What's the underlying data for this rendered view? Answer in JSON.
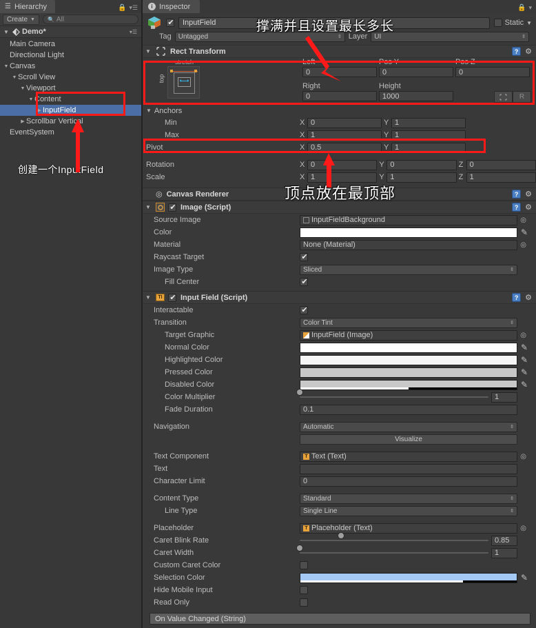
{
  "hierarchy": {
    "tab_label": "Hierarchy",
    "tab_icon": "list-icon",
    "lock_icon": "lock-icon",
    "menu_icon": "panel-menu-icon",
    "create_label": "Create",
    "search_placeholder": "All",
    "search_value": "",
    "scene_name": "Demo*",
    "items": [
      {
        "label": "Main Camera",
        "depth": 1,
        "arrow": "none",
        "selected": false
      },
      {
        "label": "Directional Light",
        "depth": 1,
        "arrow": "none",
        "selected": false
      },
      {
        "label": "Canvas",
        "depth": 1,
        "arrow": "expanded",
        "selected": false
      },
      {
        "label": "Scroll View",
        "depth": 2,
        "arrow": "expanded",
        "selected": false
      },
      {
        "label": "Viewport",
        "depth": 3,
        "arrow": "expanded",
        "selected": false
      },
      {
        "label": "Content",
        "depth": 4,
        "arrow": "expanded",
        "selected": false
      },
      {
        "label": "InputField",
        "depth": 5,
        "arrow": "collapsed",
        "selected": true
      },
      {
        "label": "Scrollbar Vertical",
        "depth": 3,
        "arrow": "collapsed",
        "selected": false
      },
      {
        "label": "EventSystem",
        "depth": 1,
        "arrow": "none",
        "selected": false
      }
    ],
    "annotation": "创建一个InputField"
  },
  "inspector": {
    "tab_label": "Inspector",
    "tab_icon": "info-icon",
    "lock_icon": "lock-icon",
    "object": {
      "enabled": true,
      "name": "InputField",
      "static_label": "Static",
      "static_checked": false,
      "tag_label": "Tag",
      "tag_value": "Untagged",
      "layer_label": "Layer",
      "layer_value": "UI"
    },
    "rect_transform": {
      "title": "Rect Transform",
      "anchor_preset_h": "stretch",
      "anchor_preset_v": "top",
      "fields": {
        "left_label": "Left",
        "left_value": "0",
        "posy_label": "Pos Y",
        "posy_value": "0",
        "posz_label": "Pos Z",
        "posz_value": "0",
        "right_label": "Right",
        "right_value": "0",
        "height_label": "Height",
        "height_value": "1000"
      },
      "blueprint_label": "",
      "raw_label": "R",
      "anchors_label": "Anchors",
      "min_label": "Min",
      "min_x": "0",
      "min_y": "1",
      "max_label": "Max",
      "max_x": "1",
      "max_y": "1",
      "pivot_label": "Pivot",
      "pivot_x": "0.5",
      "pivot_y": "1",
      "rotation_label": "Rotation",
      "rot_x": "0",
      "rot_y": "0",
      "rot_z": "0",
      "scale_label": "Scale",
      "scale_x": "1",
      "scale_y": "1",
      "scale_z": "1"
    },
    "canvas_renderer": {
      "title": "Canvas Renderer",
      "icon": "eye-icon"
    },
    "image_script": {
      "title": "Image (Script)",
      "enabled": true,
      "source_image_label": "Source Image",
      "source_image_value": "InputFieldBackground",
      "color_label": "Color",
      "color_value": "#FFFFFF",
      "material_label": "Material",
      "material_value": "None (Material)",
      "raycast_label": "Raycast Target",
      "raycast_checked": true,
      "image_type_label": "Image Type",
      "image_type_value": "Sliced",
      "fill_center_label": "Fill Center",
      "fill_center_checked": true
    },
    "input_field_script": {
      "title": "Input Field (Script)",
      "enabled": true,
      "interactable_label": "Interactable",
      "interactable_checked": true,
      "transition_label": "Transition",
      "transition_value": "Color Tint",
      "target_graphic_label": "Target Graphic",
      "target_graphic_value": "InputField (Image)",
      "normal_color_label": "Normal Color",
      "normal_color_value": "#FFFFFF",
      "highlighted_color_label": "Highlighted Color",
      "highlighted_color_value": "#F5F5F5",
      "pressed_color_label": "Pressed Color",
      "pressed_color_value": "#C8C8C8",
      "disabled_color_label": "Disabled Color",
      "disabled_color_value": "#C8C8C8",
      "disabled_color_alpha_pct": 50,
      "color_multiplier_label": "Color Multiplier",
      "color_multiplier_value": "1",
      "color_multiplier_pct": 0,
      "fade_duration_label": "Fade Duration",
      "fade_duration_value": "0.1",
      "navigation_label": "Navigation",
      "navigation_value": "Automatic",
      "visualize_label": "Visualize",
      "text_component_label": "Text Component",
      "text_component_value": "Text (Text)",
      "text_label": "Text",
      "text_value": "",
      "character_limit_label": "Character Limit",
      "character_limit_value": "0",
      "content_type_label": "Content Type",
      "content_type_value": "Standard",
      "line_type_label": "Line Type",
      "line_type_value": "Single Line",
      "placeholder_label": "Placeholder",
      "placeholder_value": "Placeholder (Text)",
      "caret_blink_label": "Caret Blink Rate",
      "caret_blink_value": "0.85",
      "caret_blink_pct": 22,
      "caret_width_label": "Caret Width",
      "caret_width_value": "1",
      "caret_width_pct": 0,
      "custom_caret_label": "Custom Caret Color",
      "custom_caret_checked": false,
      "selection_color_label": "Selection Color",
      "selection_color_value": "#A5C9F5",
      "selection_color_alpha_pct": 75,
      "hide_mobile_label": "Hide Mobile Input",
      "hide_mobile_checked": false,
      "read_only_label": "Read Only",
      "read_only_checked": false,
      "event_label": "On Value Changed (String)"
    }
  },
  "annotations": {
    "note_top": "撑满并且设置最长多长",
    "note_mid": "顶点放在最顶部",
    "highlight_color": "#FF1A1A"
  }
}
